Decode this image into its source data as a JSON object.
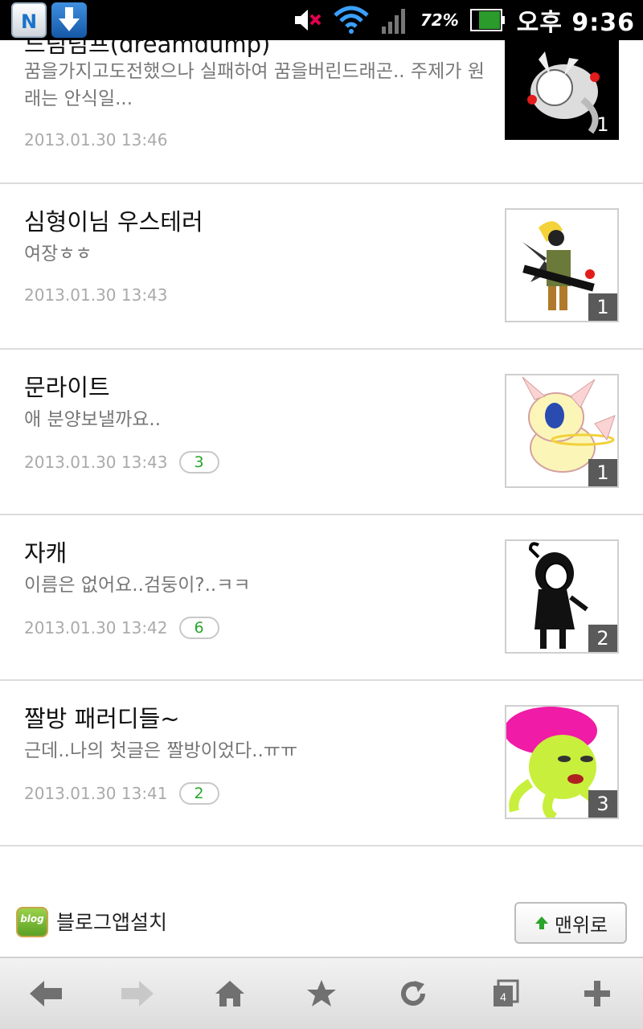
{
  "status_bar": {
    "battery_percent": "72%",
    "time": "오후 9:36",
    "app_icons": [
      "naver-app-icon",
      "download-icon"
    ]
  },
  "posts": [
    {
      "title": "드림덤프(dreamdump)",
      "summary": "꿈을가지고도전했으나 실패하여 꿈을버린드래곤.. 주제가 원래는 안식일...",
      "date": "2013.01.30 13:46",
      "comments": null,
      "image_count": "1"
    },
    {
      "title": "심형이님 우스테러",
      "summary": "여장ㅎㅎ",
      "date": "2013.01.30 13:43",
      "comments": null,
      "image_count": "1"
    },
    {
      "title": "문라이트",
      "summary": "애 분양보낼까요..",
      "date": "2013.01.30 13:43",
      "comments": "3",
      "image_count": "1"
    },
    {
      "title": "자캐",
      "summary": "이름은 없어요..검둥이?..ㅋㅋ",
      "date": "2013.01.30 13:42",
      "comments": "6",
      "image_count": "2"
    },
    {
      "title": "짤방 패러디들~",
      "summary": "근데..나의 첫글은 짤방이었다..ㅠㅠ",
      "date": "2013.01.30 13:41",
      "comments": "2",
      "image_count": "3"
    }
  ],
  "footer": {
    "blog_logo_text": "blog",
    "install_label": "블로그앱설치",
    "top_button_label": "맨위로"
  },
  "toolbar": {
    "buttons": [
      "back-icon",
      "forward-icon",
      "home-icon",
      "bookmark-star-icon",
      "refresh-icon",
      "tabs-icon",
      "add-icon"
    ],
    "tab_count": "4"
  },
  "colors": {
    "status_bar_bg": "#000000",
    "comment_count": "#2aa52a",
    "date_text": "#aaaaaa",
    "summary_text": "#777777"
  }
}
